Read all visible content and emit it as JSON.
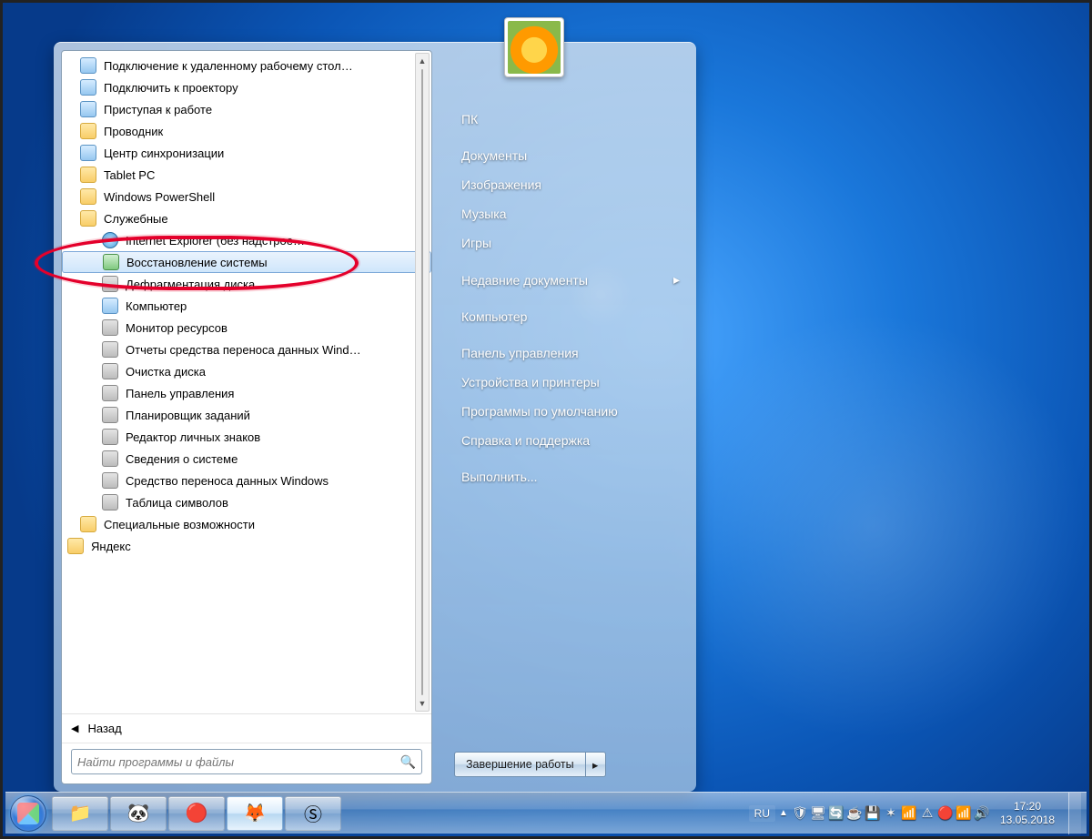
{
  "startmenu": {
    "programs": [
      {
        "label": "Подключение к удаленному рабочему стол…",
        "level": 1,
        "icon": "app"
      },
      {
        "label": "Подключить к проектору",
        "level": 1,
        "icon": "app"
      },
      {
        "label": "Приступая к работе",
        "level": 1,
        "icon": "app"
      },
      {
        "label": "Проводник",
        "level": 1,
        "icon": "folder"
      },
      {
        "label": "Центр синхронизации",
        "level": 1,
        "icon": "app"
      },
      {
        "label": "Tablet PC",
        "level": 1,
        "icon": "folder"
      },
      {
        "label": "Windows PowerShell",
        "level": 1,
        "icon": "folder"
      },
      {
        "label": "Служебные",
        "level": 1,
        "icon": "folder"
      },
      {
        "label": "Internet Explorer (без надстрое…",
        "level": 2,
        "icon": "globe"
      },
      {
        "label": "Восстановление системы",
        "level": 2,
        "icon": "restore",
        "selected": true,
        "highlight": true
      },
      {
        "label": "Дефрагментация диска",
        "level": 2,
        "icon": "tool"
      },
      {
        "label": "Компьютер",
        "level": 2,
        "icon": "app"
      },
      {
        "label": "Монитор ресурсов",
        "level": 2,
        "icon": "tool"
      },
      {
        "label": "Отчеты средства переноса данных Wind…",
        "level": 2,
        "icon": "tool"
      },
      {
        "label": "Очистка диска",
        "level": 2,
        "icon": "tool"
      },
      {
        "label": "Панель управления",
        "level": 2,
        "icon": "tool"
      },
      {
        "label": "Планировщик заданий",
        "level": 2,
        "icon": "tool"
      },
      {
        "label": "Редактор личных знаков",
        "level": 2,
        "icon": "tool"
      },
      {
        "label": "Сведения о системе",
        "level": 2,
        "icon": "tool"
      },
      {
        "label": "Средство переноса данных Windows",
        "level": 2,
        "icon": "tool"
      },
      {
        "label": "Таблица символов",
        "level": 2,
        "icon": "tool"
      },
      {
        "label": "Специальные возможности",
        "level": 1,
        "icon": "folder"
      },
      {
        "label": "Яндекс",
        "level": 0,
        "icon": "folder"
      }
    ],
    "back_label": "Назад",
    "search_placeholder": "Найти программы и файлы",
    "right_items": [
      "ПК",
      "Документы",
      "Изображения",
      "Музыка",
      "Игры",
      "Недавние документы",
      "Компьютер",
      "Панель управления",
      "Устройства и принтеры",
      "Программы по умолчанию",
      "Справка и поддержка",
      "Выполнить..."
    ],
    "right_submenu_index": 5,
    "shutdown_label": "Завершение работы"
  },
  "taskbar": {
    "language": "RU",
    "clock_time": "17:20",
    "clock_date": "13.05.2018",
    "pinned": [
      {
        "name": "explorer-icon",
        "glyph": "📁",
        "active": false
      },
      {
        "name": "panda-icon",
        "glyph": "🐼",
        "active": false
      },
      {
        "name": "opera-icon",
        "glyph": "🔴",
        "active": false
      },
      {
        "name": "firefox-icon",
        "glyph": "🦊",
        "active": true
      },
      {
        "name": "skype-icon",
        "glyph": "Ⓢ",
        "active": false
      }
    ],
    "tray": [
      {
        "name": "tray-shield-icon",
        "glyph": "🛡"
      },
      {
        "name": "tray-monitor-icon",
        "glyph": "🖥"
      },
      {
        "name": "tray-updates-icon",
        "glyph": "🔄"
      },
      {
        "name": "tray-java-icon",
        "glyph": "☕"
      },
      {
        "name": "tray-disk-icon",
        "glyph": "💾"
      },
      {
        "name": "tray-av-icon",
        "glyph": "✶"
      },
      {
        "name": "tray-network1-icon",
        "glyph": "📶"
      },
      {
        "name": "tray-warning-icon",
        "glyph": "⚠"
      },
      {
        "name": "tray-opera-icon",
        "glyph": "🔴"
      },
      {
        "name": "tray-network2-icon",
        "glyph": "📶"
      },
      {
        "name": "tray-volume-icon",
        "glyph": "🔊"
      }
    ]
  }
}
